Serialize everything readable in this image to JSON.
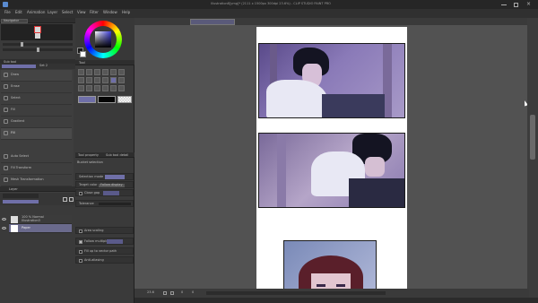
{
  "titlebar": {
    "title": "Illustration8[ymg]* (2111 x 1500px 300dpi 23.6%) - CLIP STUDIO PAINT PRO"
  },
  "menu": [
    "File",
    "Edit",
    "Animation",
    "Layer",
    "Select",
    "View",
    "Filter",
    "Window",
    "Help"
  ],
  "navigator": {
    "tab": "Navigator"
  },
  "sub_tool_panel": {
    "tabs": [
      "Sub tool",
      "Set 2"
    ],
    "tool_panel_title": "Tool",
    "items": [
      "Draw",
      "Erase",
      "Select",
      "Fill",
      "Gradient",
      "Figure",
      "Frame",
      "Guide",
      "Text",
      "Correction"
    ],
    "tools": [
      "Move",
      "Pen",
      "Brush",
      "Selection area",
      "Airbrush",
      "Figure",
      "Text"
    ]
  },
  "fill_panel": {
    "title": "Fill",
    "items": [
      "Auto Select",
      "Fill",
      "Color",
      "Gradient",
      "Auto Fill",
      "Fill Transform",
      "Mesh Transformation",
      "Free Transform"
    ],
    "selected": "Fill"
  },
  "tool_property": {
    "tabs": [
      "Tool property",
      "Sub tool detail"
    ],
    "header": "Bucket selection",
    "rows": [
      {
        "label": "Selection mode",
        "value": "Add selection"
      },
      {
        "label": "Target color",
        "value": "Follow display"
      },
      {
        "label": "Close gap",
        "value": ""
      },
      {
        "label": "Tolerance",
        "value": "0"
      },
      {
        "label": "Area scaling",
        "value": ""
      },
      {
        "label": "Follow multiple",
        "value": ""
      },
      {
        "label": "Fill up to vector path",
        "value": ""
      },
      {
        "label": "Anti-aliasing",
        "value": ""
      }
    ]
  },
  "layer_panel": {
    "title": "Layer",
    "blend_mode": "Normal",
    "opacity": "100",
    "layers": [
      {
        "name": "100 % Normal",
        "sub": "Illustration3"
      },
      {
        "name": "Paper",
        "sub": ""
      }
    ]
  },
  "status": {
    "zoom": "23.6",
    "x": "0",
    "y": "0"
  },
  "colors": {
    "bg": "#2b2b2b",
    "panel": "#3a3a3a",
    "canvas_bg": "#525252",
    "accent": "#6f6fa8",
    "page": "#ffffff"
  }
}
